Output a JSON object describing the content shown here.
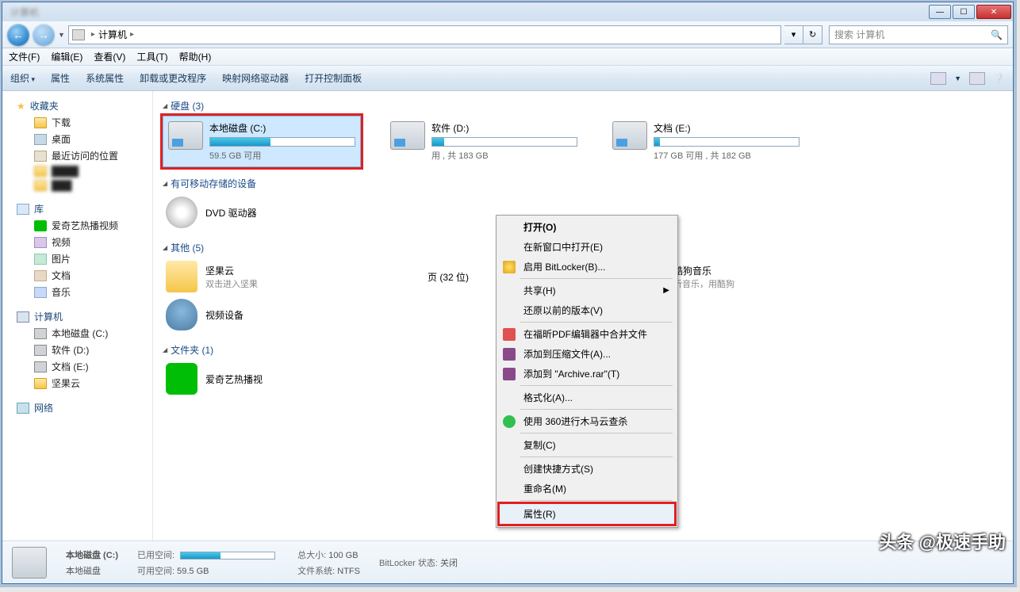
{
  "titlebar": {
    "blur_text": "计算机"
  },
  "nav": {
    "location": "计算机",
    "search_placeholder": "搜索 计算机"
  },
  "menubar": [
    "文件(F)",
    "编辑(E)",
    "查看(V)",
    "工具(T)",
    "帮助(H)"
  ],
  "toolbar": {
    "organize": "组织",
    "items": [
      "属性",
      "系统属性",
      "卸载或更改程序",
      "映射网络驱动器",
      "打开控制面板"
    ]
  },
  "sidebar": {
    "favorites": {
      "label": "收藏夹",
      "items": [
        "下载",
        "桌面",
        "最近访问的位置"
      ]
    },
    "libraries": {
      "label": "库",
      "items": [
        "爱奇艺热播视频",
        "视频",
        "图片",
        "文档",
        "音乐"
      ]
    },
    "computer": {
      "label": "计算机",
      "items": [
        "本地磁盘 (C:)",
        "软件 (D:)",
        "文档 (E:)",
        "坚果云"
      ]
    },
    "network": {
      "label": "网络"
    }
  },
  "sections": {
    "drives": {
      "label": "硬盘 (3)"
    },
    "removable": {
      "label": "有可移动存储的设备"
    },
    "other": {
      "label": "其他 (5)"
    },
    "folders": {
      "label": "文件夹 (1)"
    }
  },
  "drives": [
    {
      "name": "本地磁盘 (C:)",
      "free": "59.5 GB 可用",
      "fill": 42
    },
    {
      "name": "软件 (D:)",
      "free": "用 , 共 183 GB",
      "fill": 8
    },
    {
      "name": "文档 (E:)",
      "free": "177 GB 可用 , 共 182 GB",
      "fill": 4
    }
  ],
  "removable": {
    "dvd": "DVD 驱动器"
  },
  "other": {
    "jianguo": {
      "name": "坚果云",
      "sub": "双击进入坚果"
    },
    "video": {
      "name": "视频设备"
    },
    "system": {
      "name": "页 (32 位)"
    },
    "kugou": {
      "name": "酷狗音乐",
      "sub": "听音乐，用酷狗"
    }
  },
  "folders": {
    "iqiyi": "爱奇艺热播视"
  },
  "context_menu": {
    "open": "打开(O)",
    "open_new": "在新窗口中打开(E)",
    "bitlocker": "启用 BitLocker(B)...",
    "share": "共享(H)",
    "restore": "还原以前的版本(V)",
    "pdf": "在福昕PDF编辑器中合并文件",
    "rar_add": "添加到压缩文件(A)...",
    "rar_archive": "添加到 \"Archive.rar\"(T)",
    "format": "格式化(A)...",
    "scan360": "使用 360进行木马云查杀",
    "copy": "复制(C)",
    "shortcut": "创建快捷方式(S)",
    "rename": "重命名(M)",
    "properties": "属性(R)"
  },
  "details": {
    "title": "本地磁盘 (C:)",
    "subtitle": "本地磁盘",
    "used_label": "已用空间:",
    "free_label": "可用空间:",
    "free_value": "59.5 GB",
    "size_label": "总大小:",
    "size_value": "100 GB",
    "fs_label": "文件系统:",
    "fs_value": "NTFS",
    "bl_label": "BitLocker 状态:",
    "bl_value": "关闭"
  },
  "watermark": "头条 @极速手助"
}
